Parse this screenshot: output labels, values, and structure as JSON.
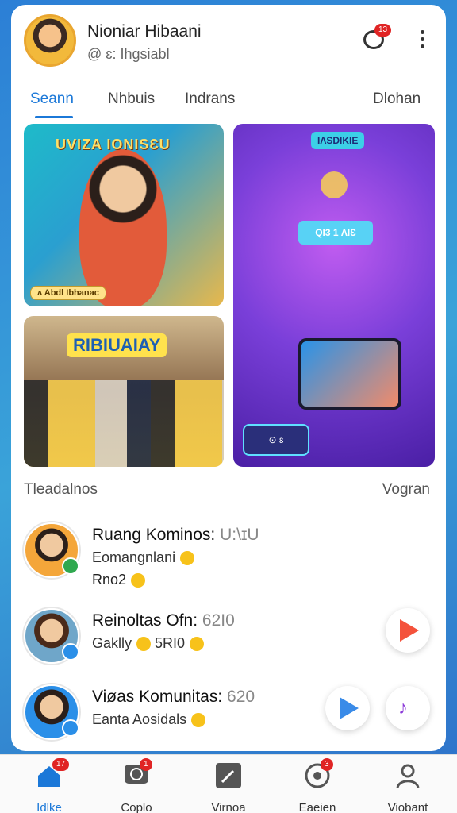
{
  "header": {
    "name": "Nioniar Hibaani",
    "handle": "@ ɛ: Ihgsiabl",
    "chat_badge": "13"
  },
  "tabs": [
    {
      "label": "Seann",
      "active": true
    },
    {
      "label": "Nhbuis",
      "active": false
    },
    {
      "label": "Indrans",
      "active": false
    },
    {
      "label": "Dlohan",
      "active": false
    }
  ],
  "media": {
    "card1_title": "UVIZA IONISƐU",
    "card1_chip": "ʌ Abdl Ibhanac",
    "card2_title": "RIBIUAIAY",
    "card3_badge": "IɅSDIKIE",
    "card3_screen": "QI3 1 ɅIƐ",
    "card3_chip": "⊙ ɛ"
  },
  "section": {
    "left": "Tleadalnos",
    "right": "Vogran"
  },
  "list": [
    {
      "title": "Ruang Kominos:",
      "num": "U:\\ɪU",
      "sub": "Eomangnlani",
      "line3": "Rno2",
      "online_color": "#2fa84f"
    },
    {
      "title": "Reinoltas Ofn:",
      "num": "62I0",
      "sub": "Gaklly",
      "sub_extra": "5RI0",
      "online_color": "#2a8fe8"
    },
    {
      "title": "Viøas Komunitas:",
      "num": "620",
      "sub": "Eanta Aosidals",
      "online_color": "#2a8fe8"
    }
  ],
  "bottom_nav": [
    {
      "label": "Idlke",
      "badge": "17",
      "active": true,
      "icon": "home-icon"
    },
    {
      "label": "Coplo",
      "badge": "1",
      "active": false,
      "icon": "chat-icon"
    },
    {
      "label": "Virnoa",
      "badge": "",
      "active": false,
      "icon": "compose-icon"
    },
    {
      "label": "Eaeien",
      "badge": "3",
      "active": false,
      "icon": "globe-chat-icon"
    },
    {
      "label": "Viobant",
      "badge": "",
      "active": false,
      "icon": "user-icon"
    }
  ],
  "colors": {
    "accent": "#1b78d8",
    "badge": "#e02424"
  }
}
